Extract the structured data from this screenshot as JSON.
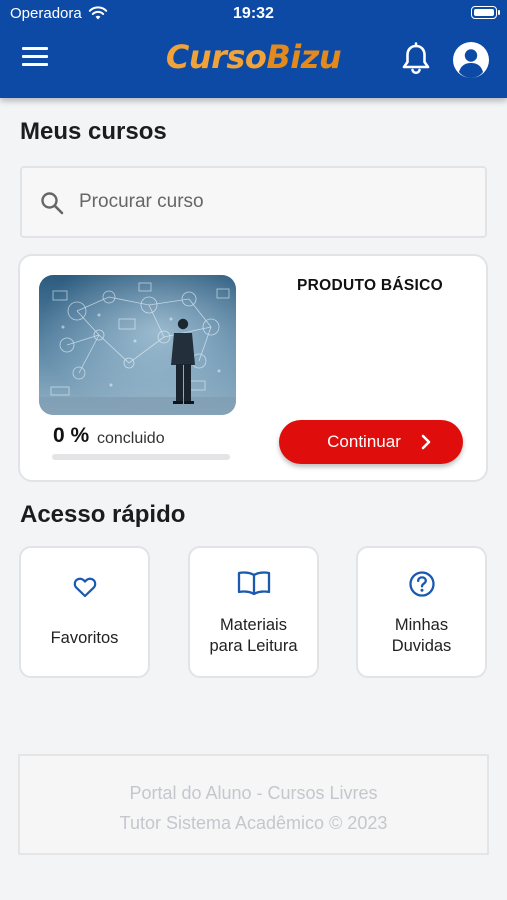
{
  "status_bar": {
    "carrier": "Operadora",
    "time": "19:32"
  },
  "header": {
    "logo_part1": "Curso",
    "logo_part2": "Bizu",
    "brand_color": "#0d4aa6",
    "icons": [
      "menu-icon",
      "bell-icon",
      "account-icon"
    ]
  },
  "my_courses": {
    "title": "Meus cursos",
    "search": {
      "placeholder": "Procurar curso",
      "value": ""
    },
    "course": {
      "name": "PRODUTO BÁSICO",
      "progress_percent": "0 %",
      "progress_value": 0,
      "progress_label": "concluido",
      "continue_label": "Continuar",
      "accent_color": "#e00d0d"
    }
  },
  "quick_access": {
    "title": "Acesso rápido",
    "items": [
      {
        "icon": "heart-icon",
        "line1": "Favoritos",
        "line2": ""
      },
      {
        "icon": "book-icon",
        "line1": "Materiais",
        "line2": "para Leitura"
      },
      {
        "icon": "question-icon",
        "line1": "Minhas",
        "line2": "Duvidas"
      }
    ]
  },
  "footer": {
    "line1": "Portal do Aluno - Cursos Livres",
    "line2": "Tutor Sistema Acadêmico © 2023"
  }
}
